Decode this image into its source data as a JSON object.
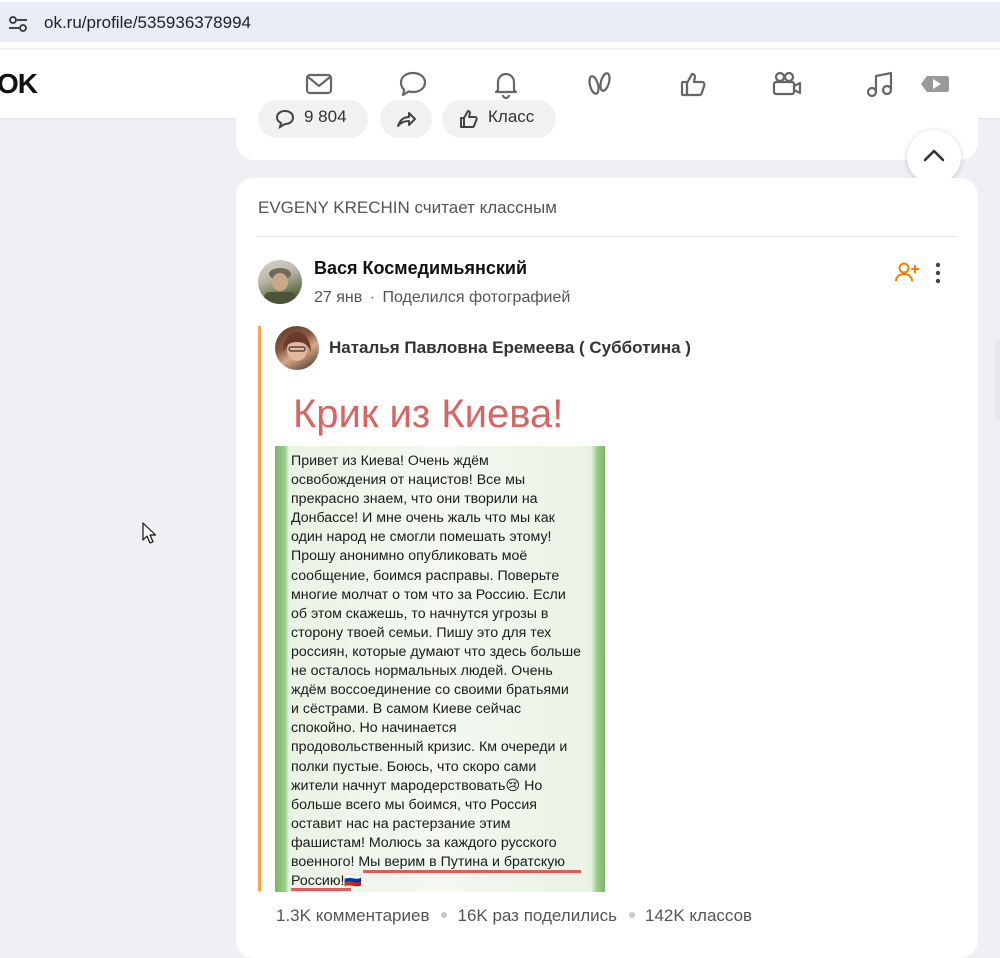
{
  "browser": {
    "url": "ok.ru/profile/535936378994"
  },
  "nav": {
    "logo": "OK",
    "icons": [
      "mail-icon",
      "chat-icon",
      "bell-icon",
      "guests-icon",
      "like-icon",
      "video-camera-icon",
      "music-icon",
      "video-play-icon"
    ]
  },
  "prev_post": {
    "comments": "9 804",
    "like_label": "Класс"
  },
  "feed_item": {
    "liker_text": "EVGENY KRECHIN считает классным",
    "author": "Вася Космедимьянский",
    "date": "27 янв",
    "action": "Поделился фотографией",
    "original_author": "Наталья Павловна Еремеева ( Субботина )",
    "photo_title": "Крик из Киева!",
    "photo_text": "Привет из Киева! Очень ждём\nосвобождения от нацистов! Все мы\nпрекрасно знаем, что они творили на\nДонбассе! И мне очень жаль что мы как\nодин народ не смогли помешать этому!\nПрошу анонимно опубликовать моё\nсообщение, боимся расправы. Поверьте\nмногие молчат о том что за Россию. Если\nоб этом скажешь, то начнутся угрозы в\nсторону твоей семьи. Пишу это для тех\nроссиян, которые думают что здесь больше\nне осталось нормальных  людей. Очень\nждём воссоединение со своими братьями\nи сёстрами. В самом Киеве сейчас\nспокойно. Но начинается\nпродовольственный кризис. Км очереди и\nполки пустые. Боюсь, что скоро сами\nжители начнут мародерствовать😢 Но\nбольше всего мы боимся, что Россия\nоставит нас на растерзание этим\nфашистам! Молюсь за каждого русского\nвоенного! Мы верим в Путина и братскую\nРоссию!🇷🇺",
    "stats": {
      "comments": "1.3K комментариев",
      "shares": "16K раз поделились",
      "likes": "142K классов"
    }
  },
  "colors": {
    "accent": "#ee8208",
    "quote_bar": "#f7a34b",
    "photo_title": "#d96464"
  }
}
